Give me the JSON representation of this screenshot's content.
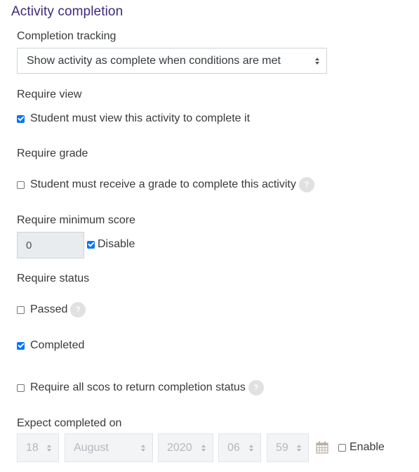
{
  "section": {
    "title": "Activity completion"
  },
  "completion_tracking": {
    "label": "Completion tracking",
    "selected": "Show activity as complete when conditions are met"
  },
  "require_view": {
    "label": "Require view",
    "checkbox_label": "Student must view this activity to complete it",
    "checked": true
  },
  "require_grade": {
    "label": "Require grade",
    "checkbox_label": "Student must receive a grade to complete this activity",
    "checked": false,
    "help_icon": "question-circle-icon",
    "help_glyph": "?"
  },
  "require_min_score": {
    "label": "Require minimum score",
    "value": "0",
    "disable_label": "Disable",
    "disable_checked": true
  },
  "require_status": {
    "label": "Require status",
    "passed_label": "Passed",
    "passed_checked": false,
    "completed_label": "Completed",
    "completed_checked": true,
    "all_scos_label": "Require all scos to return completion status",
    "all_scos_checked": false,
    "help_glyph": "?"
  },
  "expect_completed": {
    "label": "Expect completed on",
    "day": "18",
    "month": "August",
    "year": "2020",
    "hour": "06",
    "minute": "59",
    "calendar_icon": "calendar-icon",
    "enable_label": "Enable",
    "enable_checked": false
  },
  "colors": {
    "heading": "#3d2a7a",
    "checkbox_checked": "#0075ff",
    "text": "#373a3c",
    "disabled_text": "#b5b8bc"
  }
}
